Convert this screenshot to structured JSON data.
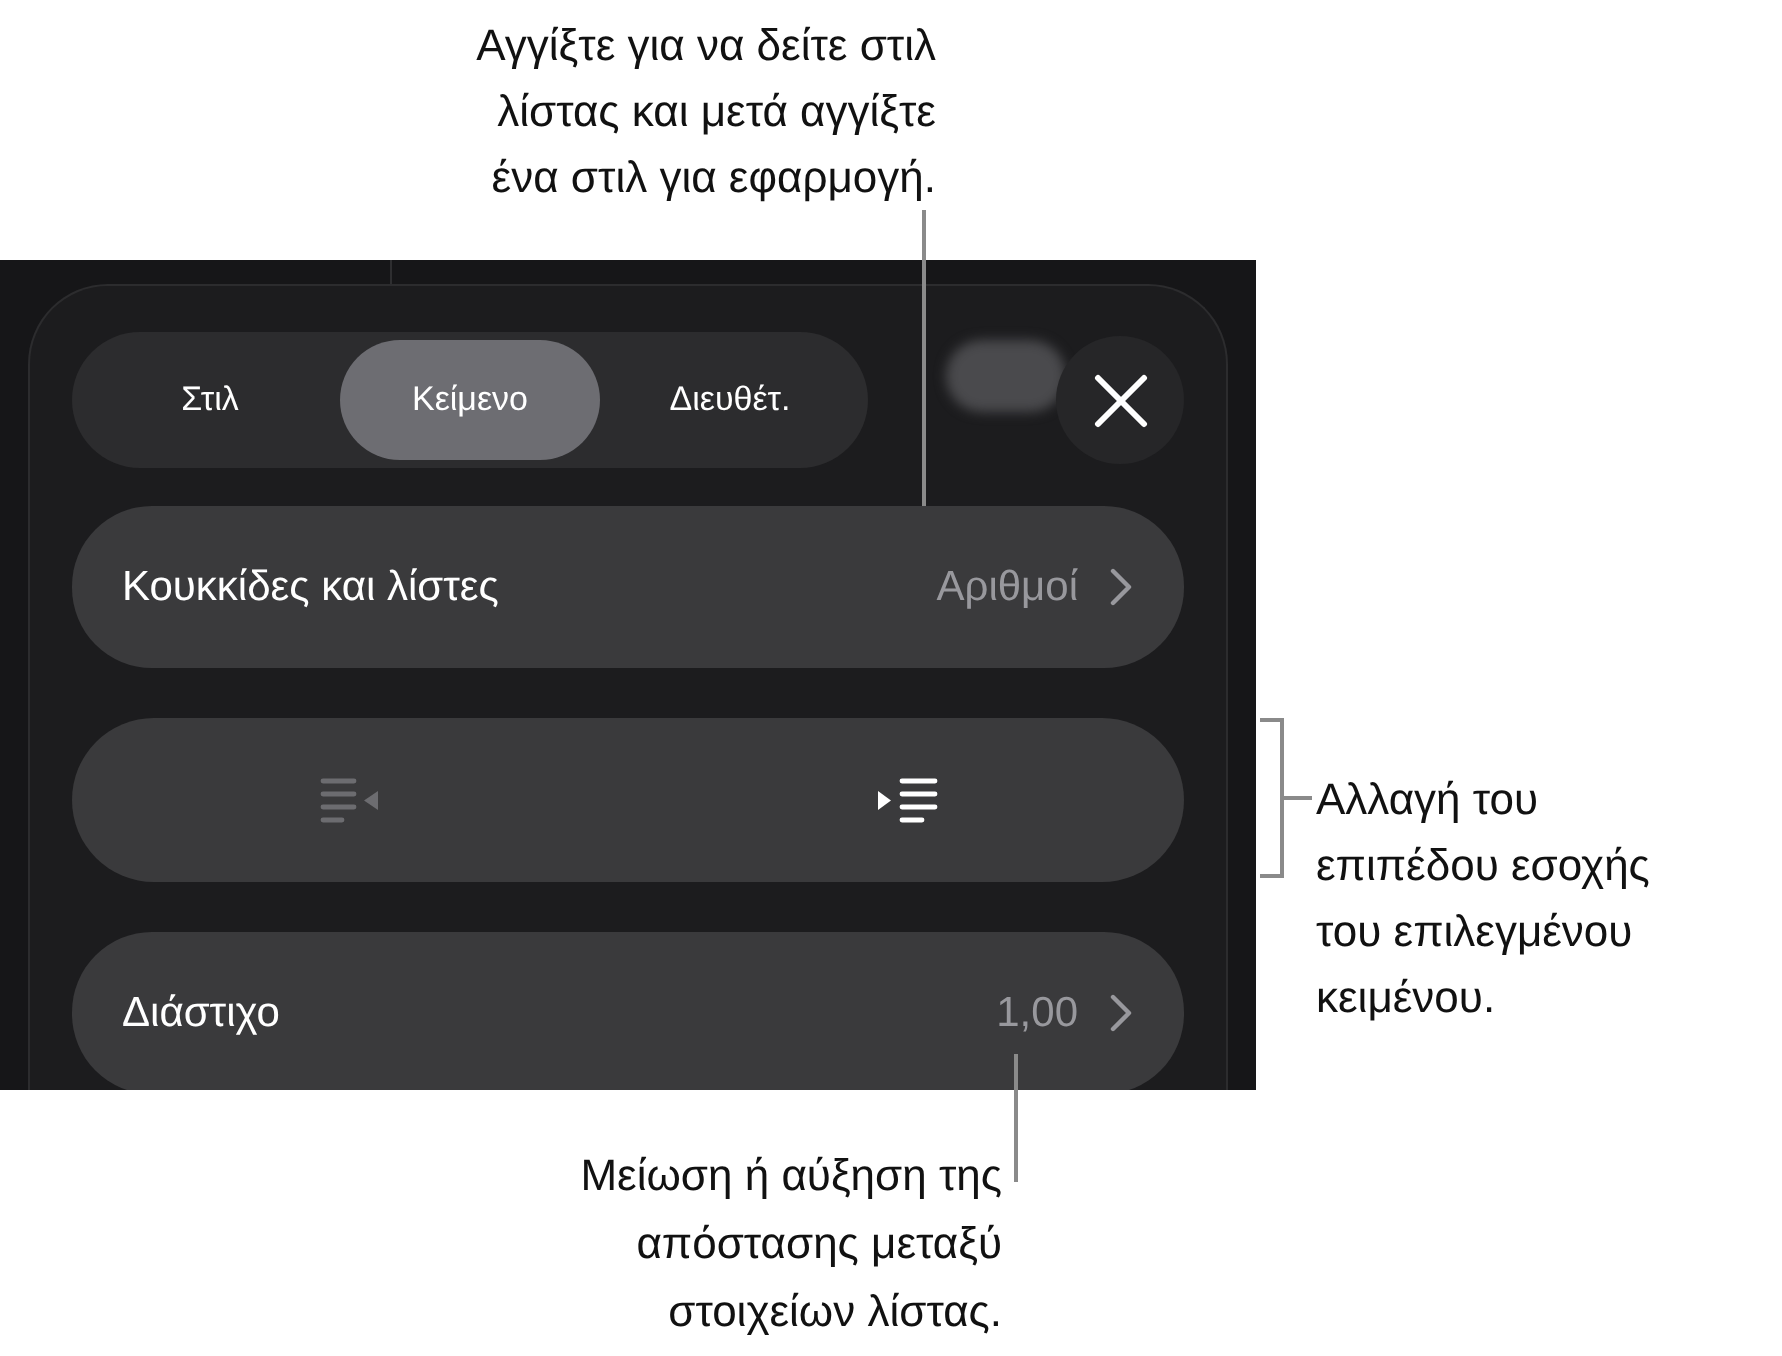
{
  "top_callout": {
    "lines": [
      "Αγγίξτε για να δείτε στιλ",
      "λίστας και μετά αγγίξτε",
      "ένα στιλ για εφαρμογή."
    ]
  },
  "panel": {
    "tabs": [
      {
        "label": "Στιλ",
        "selected": false
      },
      {
        "label": "Κείμενο",
        "selected": true
      },
      {
        "label": "Διευθέτ.",
        "selected": false
      }
    ],
    "rows": [
      {
        "kind": "disclosure",
        "label": "Κουκκίδες και λίστες",
        "value": "Αριθμοί"
      },
      {
        "kind": "indent",
        "buttons": [
          {
            "kind": "outdent",
            "disabled": true
          },
          {
            "kind": "indent",
            "disabled": false
          }
        ]
      },
      {
        "kind": "disclosure",
        "label": "Διάστιχο",
        "value": "1,00"
      }
    ]
  },
  "side_callout": {
    "lines": [
      "Αλλαγή του",
      "επιπέδου εσοχής",
      "του επιλεγμένου",
      "κειμένου."
    ]
  },
  "bottom_callout": {
    "lines": [
      "Μείωση ή αύξηση της",
      "απόστασης μεταξύ",
      "στοιχείων λίστας."
    ]
  }
}
